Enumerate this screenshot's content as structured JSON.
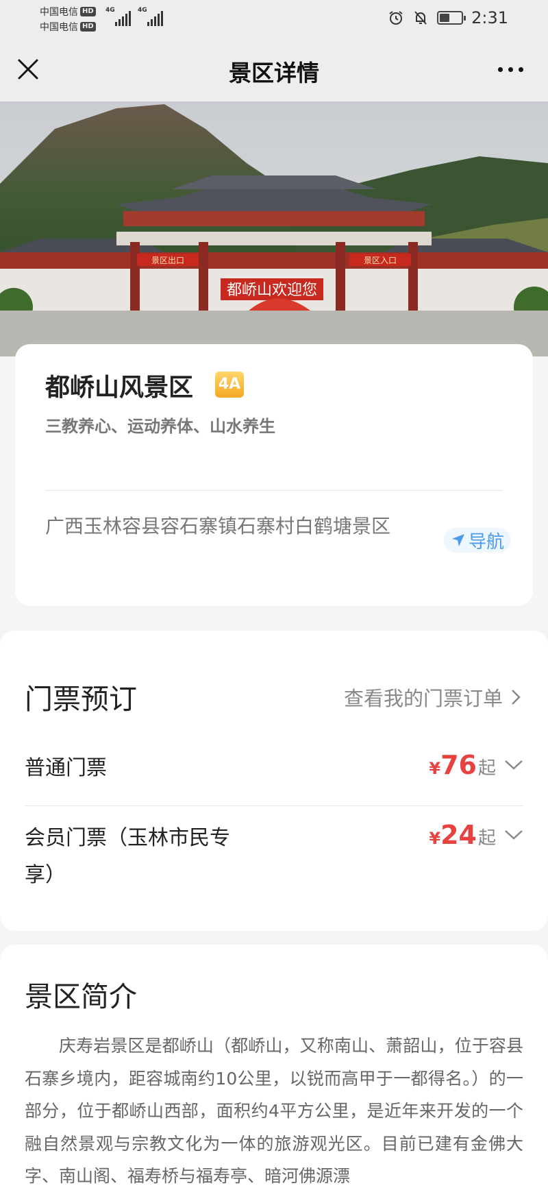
{
  "status_bar": {
    "carrier_1": "中国电信",
    "carrier_2": "中国电信",
    "hd_label": "HD",
    "network_1": "4G",
    "network_2": "4G",
    "time": "2:31",
    "battery_level": 0.45
  },
  "nav": {
    "title": "景区详情",
    "close_icon": "close-icon",
    "more_icon": "more-icon"
  },
  "hero": {
    "gate_sign": "都峤山欢迎您",
    "left_sign": "景区出口",
    "right_sign": "景区入口"
  },
  "info": {
    "name": "都峤山风景区",
    "level": "4A",
    "slogan": "三教养心、运动养体、山水养生",
    "address": "广西玉林容县容石寨镇石寨村白鹤塘景区",
    "nav_button": "导航"
  },
  "tickets": {
    "title": "门票预订",
    "my_orders": "查看我的门票订单",
    "items": [
      {
        "name": "普通门票",
        "currency": "¥",
        "price": "76",
        "suffix": "起"
      },
      {
        "name": "会员门票（玉林市民专享）",
        "currency": "¥",
        "price": "24",
        "suffix": "起"
      }
    ]
  },
  "intro": {
    "title": "景区简介",
    "text": "庆寿岩景区是都峤山（都峤山，又称南山、萧韶山，位于容县石寨乡境内，距容城南约10公里，以锐而高甲于一都得名。）的一部分，位于都峤山西部，面积约4平方公里，是近年来开发的一个融自然景观与宗教文化为一体的旅游观光区。目前已建有金佛大字、南山阁、福寿桥与福寿亭、暗河佛源漂"
  },
  "colors": {
    "price_red": "#e64340",
    "badge_orange": "#f5a623",
    "nav_blue": "#4d9be8",
    "bar_gray": "#ededed"
  }
}
